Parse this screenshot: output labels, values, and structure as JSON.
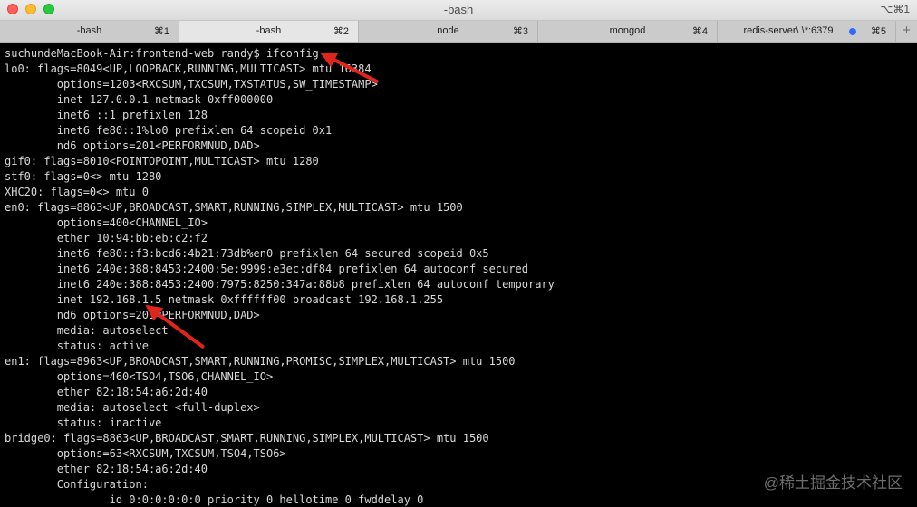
{
  "window": {
    "title": "-bash",
    "shortcut": "⌥⌘1"
  },
  "tabs": [
    {
      "label": "-bash",
      "shortcut": "⌘1",
      "active": false
    },
    {
      "label": "-bash",
      "shortcut": "⌘2",
      "active": true
    },
    {
      "label": "node",
      "shortcut": "⌘3",
      "active": false
    },
    {
      "label": "mongod",
      "shortcut": "⌘4",
      "active": false
    },
    {
      "label": "redis-server\\ \\*:6379",
      "shortcut": "⌘5",
      "active": false,
      "activity_dot": true
    }
  ],
  "tab_add_label": "+",
  "terminal": {
    "lines": [
      "suchundeMacBook-Air:frontend-web randy$ ifconfig",
      "lo0: flags=8049<UP,LOOPBACK,RUNNING,MULTICAST> mtu 16384",
      "        options=1203<RXCSUM,TXCSUM,TXSTATUS,SW_TIMESTAMP>",
      "        inet 127.0.0.1 netmask 0xff000000",
      "        inet6 ::1 prefixlen 128",
      "        inet6 fe80::1%lo0 prefixlen 64 scopeid 0x1",
      "        nd6 options=201<PERFORMNUD,DAD>",
      "gif0: flags=8010<POINTOPOINT,MULTICAST> mtu 1280",
      "stf0: flags=0<> mtu 1280",
      "XHC20: flags=0<> mtu 0",
      "en0: flags=8863<UP,BROADCAST,SMART,RUNNING,SIMPLEX,MULTICAST> mtu 1500",
      "        options=400<CHANNEL_IO>",
      "        ether 10:94:bb:eb:c2:f2",
      "        inet6 fe80::f3:bcd6:4b21:73db%en0 prefixlen 64 secured scopeid 0x5",
      "        inet6 240e:388:8453:2400:5e:9999:e3ec:df84 prefixlen 64 autoconf secured",
      "        inet6 240e:388:8453:2400:7975:8250:347a:88b8 prefixlen 64 autoconf temporary",
      "        inet 192.168.1.5 netmask 0xffffff00 broadcast 192.168.1.255",
      "        nd6 options=201<PERFORMNUD,DAD>",
      "        media: autoselect",
      "        status: active",
      "en1: flags=8963<UP,BROADCAST,SMART,RUNNING,PROMISC,SIMPLEX,MULTICAST> mtu 1500",
      "        options=460<TSO4,TSO6,CHANNEL_IO>",
      "        ether 82:18:54:a6:2d:40",
      "        media: autoselect <full-duplex>",
      "        status: inactive",
      "bridge0: flags=8863<UP,BROADCAST,SMART,RUNNING,SIMPLEX,MULTICAST> mtu 1500",
      "        options=63<RXCSUM,TXCSUM,TSO4,TSO6>",
      "        ether 82:18:54:a6:2d:40",
      "        Configuration:",
      "                id 0:0:0:0:0:0 priority 0 hellotime 0 fwddelay 0"
    ]
  },
  "watermark": "@稀土掘金技术社区",
  "colors": {
    "arrow": "#e0251c",
    "terminal_bg": "#000000",
    "terminal_fg": "#d9d9d9"
  }
}
